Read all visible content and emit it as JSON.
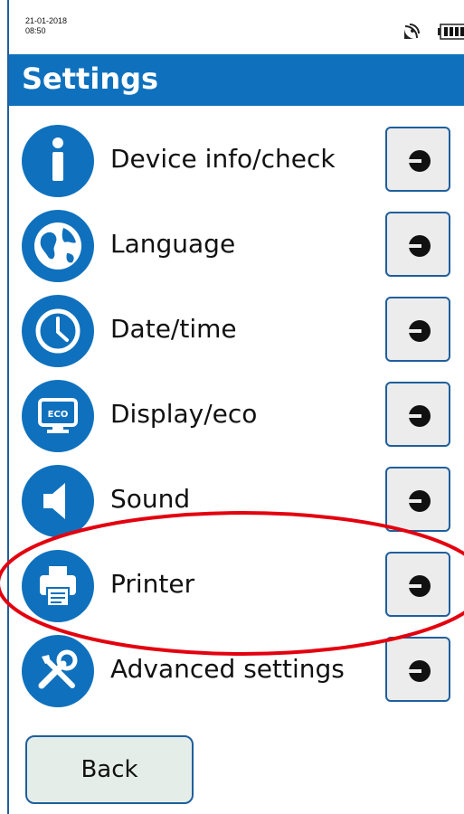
{
  "status": {
    "date": "21-01-2018",
    "time": "08:50"
  },
  "header": {
    "title": "Settings"
  },
  "menu": {
    "items": [
      {
        "label": "Device info/check"
      },
      {
        "label": "Language"
      },
      {
        "label": "Date/time"
      },
      {
        "label": "Display/eco"
      },
      {
        "label": "Sound"
      },
      {
        "label": "Printer"
      },
      {
        "label": "Advanced settings"
      }
    ],
    "eco_badge": "ECO"
  },
  "footer": {
    "back_label": "Back"
  },
  "colors": {
    "accent": "#0f71bd",
    "border": "#1f5f9c",
    "highlight": "#e3000f"
  }
}
